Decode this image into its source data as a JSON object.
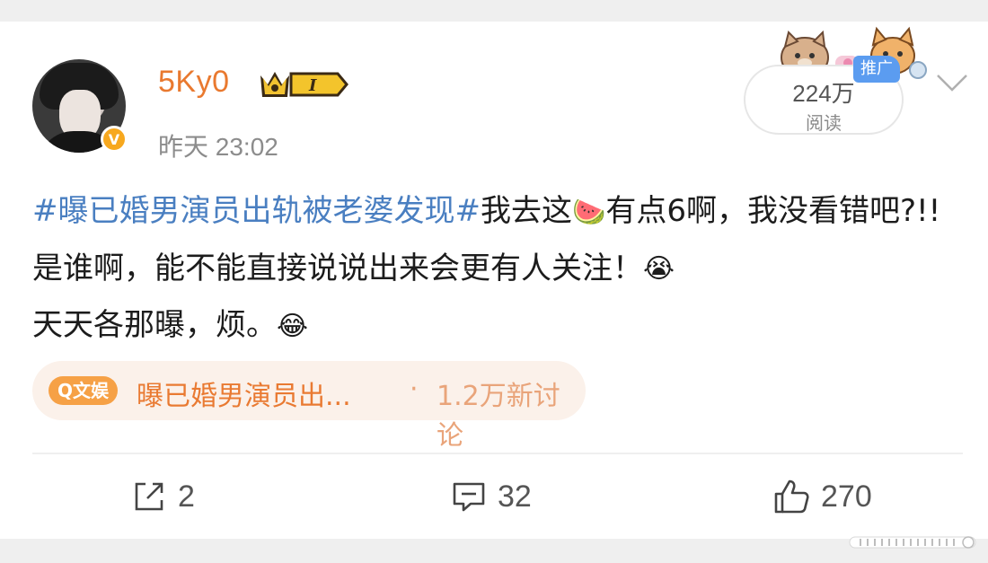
{
  "post": {
    "author": {
      "name": "5Ky0",
      "verified_badge": "V",
      "level_badge": "I",
      "icons": [
        "avatar-photo",
        "verified-icon",
        "crown-level-icon"
      ]
    },
    "timestamp": "昨天 23:02",
    "views": {
      "count": "224万",
      "label": "阅读"
    },
    "ad_tag": "推广",
    "text": {
      "hashtag": "#曝已婚男演员出轨被老婆发现#",
      "part1": "我去这",
      "emoji1": "🍉",
      "part2": "有点6啊，我没看错吧?!! 是谁啊，能不能直接说说出来会更有人关注！",
      "emoji2": "😭",
      "part3": "天天各那曝，烦。",
      "emoji3": "😂"
    },
    "topic": {
      "tag": "Q文娱",
      "title": "曝已婚男演员出...",
      "separator": "·",
      "discussion": "1.2万新讨论"
    },
    "actions": {
      "share_count": "2",
      "comment_count": "32",
      "like_count": "270"
    },
    "colors": {
      "accent_orange": "#e9792f",
      "hashtag_blue": "#4a7fc1",
      "ad_blue": "#5b9cf0",
      "topic_bg": "#fbf1ea"
    }
  }
}
